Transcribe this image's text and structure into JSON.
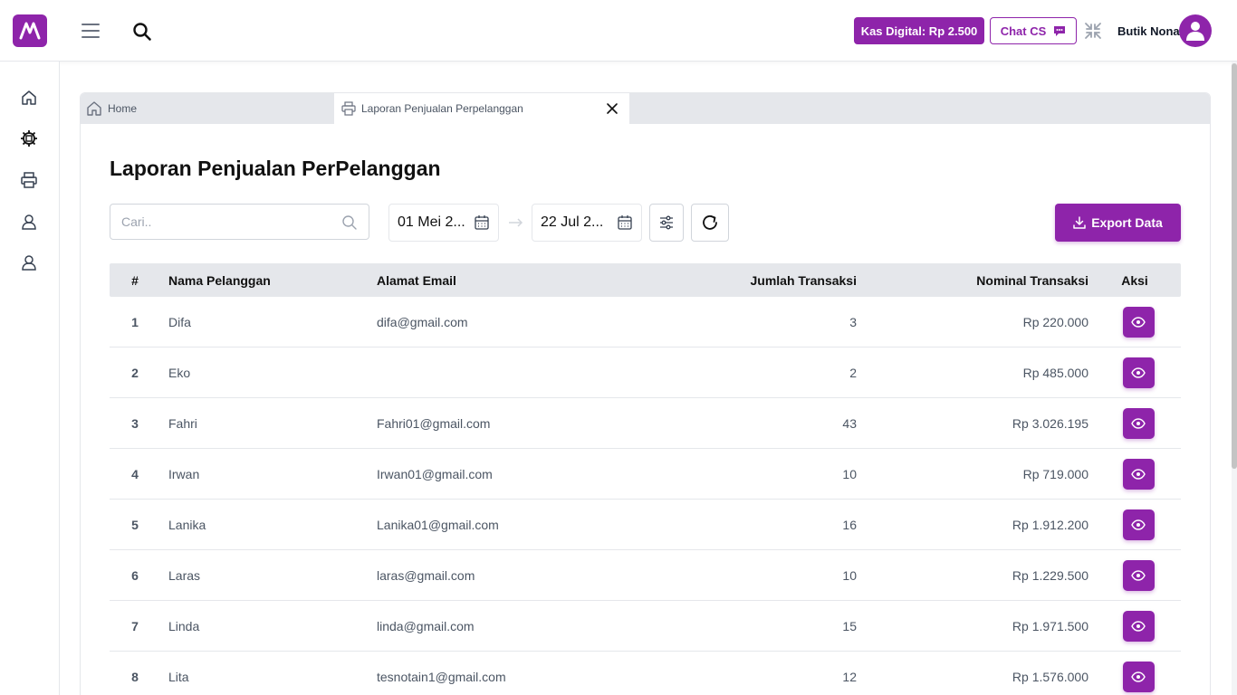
{
  "header": {
    "kas_label": "Kas Digital: Rp 2.500",
    "chat_label": "Chat CS",
    "user_name": "Butik Nona"
  },
  "sidebar": {
    "items": [
      {
        "icon": "home-icon"
      },
      {
        "icon": "gear-icon"
      },
      {
        "icon": "printer-icon"
      },
      {
        "icon": "user-report-icon"
      },
      {
        "icon": "user-report-icon"
      }
    ]
  },
  "tabs": {
    "home_label": "Home",
    "active_label": "Laporan Penjualan Perpelanggan"
  },
  "page": {
    "title": "Laporan Penjualan PerPelanggan",
    "search_placeholder": "Cari..",
    "date_from": "01 Mei 2...",
    "date_to": "22 Jul 2...",
    "export_label": "Export Data"
  },
  "table": {
    "headers": {
      "num": "#",
      "name": "Nama Pelanggan",
      "email": "Alamat Email",
      "count": "Jumlah Transaksi",
      "amount": "Nominal Transaksi",
      "action": "Aksi"
    },
    "rows": [
      {
        "num": "1",
        "name": "Difa",
        "email": "difa@gmail.com",
        "count": "3",
        "amount": "Rp 220.000"
      },
      {
        "num": "2",
        "name": "Eko",
        "email": "",
        "count": "2",
        "amount": "Rp 485.000"
      },
      {
        "num": "3",
        "name": "Fahri",
        "email": "Fahri01@gmail.com",
        "count": "43",
        "amount": "Rp 3.026.195"
      },
      {
        "num": "4",
        "name": "Irwan",
        "email": "Irwan01@gmail.com",
        "count": "10",
        "amount": "Rp 719.000"
      },
      {
        "num": "5",
        "name": "Lanika",
        "email": "Lanika01@gmail.com",
        "count": "16",
        "amount": "Rp 1.912.200"
      },
      {
        "num": "6",
        "name": "Laras",
        "email": "laras@gmail.com",
        "count": "10",
        "amount": "Rp 1.229.500"
      },
      {
        "num": "7",
        "name": "Linda",
        "email": "linda@gmail.com",
        "count": "15",
        "amount": "Rp 1.971.500"
      },
      {
        "num": "8",
        "name": "Lita",
        "email": "tesnotain1@gmail.com",
        "count": "12",
        "amount": "Rp 1.576.000"
      }
    ]
  },
  "colors": {
    "brand": "#8e24aa",
    "header_bg": "#e5e7eb"
  }
}
